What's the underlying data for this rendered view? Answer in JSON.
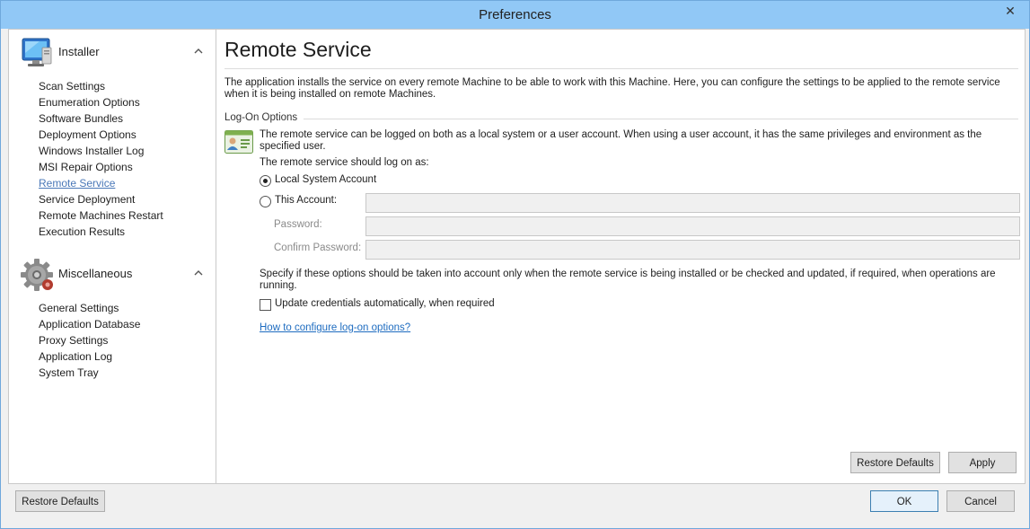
{
  "window": {
    "title": "Preferences",
    "close_glyph": "✕"
  },
  "sidebar": {
    "groups": [
      {
        "label": "Installer",
        "icon": "monitor-icon",
        "items": [
          {
            "label": "Scan Settings"
          },
          {
            "label": "Enumeration Options"
          },
          {
            "label": "Software Bundles"
          },
          {
            "label": "Deployment Options"
          },
          {
            "label": "Windows Installer Log"
          },
          {
            "label": "MSI Repair Options"
          },
          {
            "label": "Remote Service",
            "active": true
          },
          {
            "label": "Service Deployment"
          },
          {
            "label": "Remote Machines Restart"
          },
          {
            "label": "Execution Results"
          }
        ]
      },
      {
        "label": "Miscellaneous",
        "icon": "gear-icon",
        "items": [
          {
            "label": "General Settings"
          },
          {
            "label": "Application Database"
          },
          {
            "label": "Proxy Settings"
          },
          {
            "label": "Application Log"
          },
          {
            "label": "System Tray"
          }
        ]
      }
    ]
  },
  "main": {
    "title": "Remote Service",
    "description": "The application installs the service on every remote Machine to be able to work with this Machine. Here, you can configure the settings to be applied to the remote service when it is being installed on remote Machines.",
    "logon": {
      "section_title": "Log-On Options",
      "description": "The remote service can be logged on both as a local system or a user account. When using a user account, it has the same privileges and environment as the specified user.",
      "logon_as_label": "The remote service should log on as:",
      "local_system_label": "Local System Account",
      "this_account_label": "This Account:",
      "password_label": "Password:",
      "confirm_password_label": "Confirm Password:",
      "this_account_value": "",
      "password_value": "",
      "confirm_password_value": ""
    },
    "specify_desc": "Specify if these options should be taken into account only when the remote service is being installed or be checked and updated, if required, when operations are running.",
    "update_credentials_label": "Update credentials automatically, when required",
    "help_link": "How to configure log-on options?",
    "restore_defaults_label": "Restore Defaults",
    "apply_label": "Apply"
  },
  "footer": {
    "restore_defaults_label": "Restore Defaults",
    "ok_label": "OK",
    "cancel_label": "Cancel"
  },
  "colors": {
    "titlebar": "#91c8f6",
    "link": "#1e6cc0",
    "active_item": "#4a78b8"
  }
}
